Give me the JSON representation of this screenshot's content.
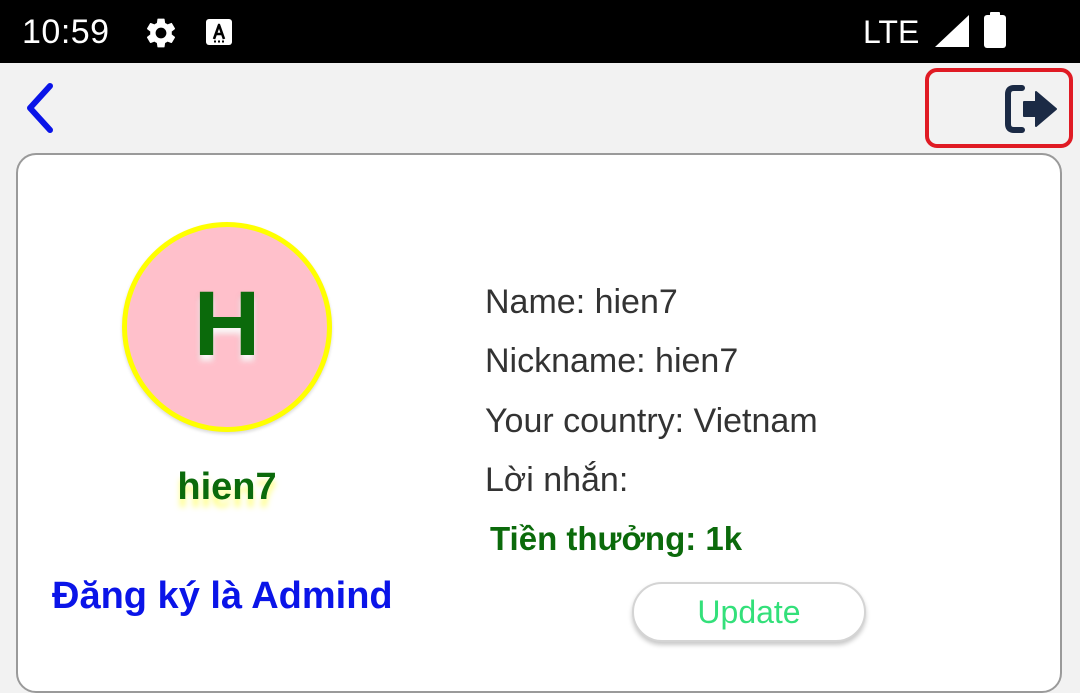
{
  "status_bar": {
    "time": "10:59",
    "network": "LTE",
    "icons": [
      "gear-icon",
      "accessibility-a-icon",
      "signal-icon",
      "battery-icon"
    ]
  },
  "app_bar": {
    "back_icon": "chevron-left-icon",
    "logout_icon": "logout-icon",
    "highlight_color": "#e01b24"
  },
  "profile": {
    "avatar_letter": "H",
    "username": "hien7",
    "register_admin": "Đăng ký là Admind",
    "name_line": "Name: hien7",
    "nickname_line": "Nickname: hien7",
    "country_line": "Your country: Vietnam",
    "message_line": "Lời nhắn:",
    "reward_line": "Tiền thưởng: 1k",
    "update_label": "Update"
  },
  "colors": {
    "avatar_bg": "#ffc0cb",
    "avatar_border": "#ffff00",
    "green_text": "#0b6a0b",
    "link_blue": "#0a14e8",
    "update_text": "#33e07a"
  }
}
